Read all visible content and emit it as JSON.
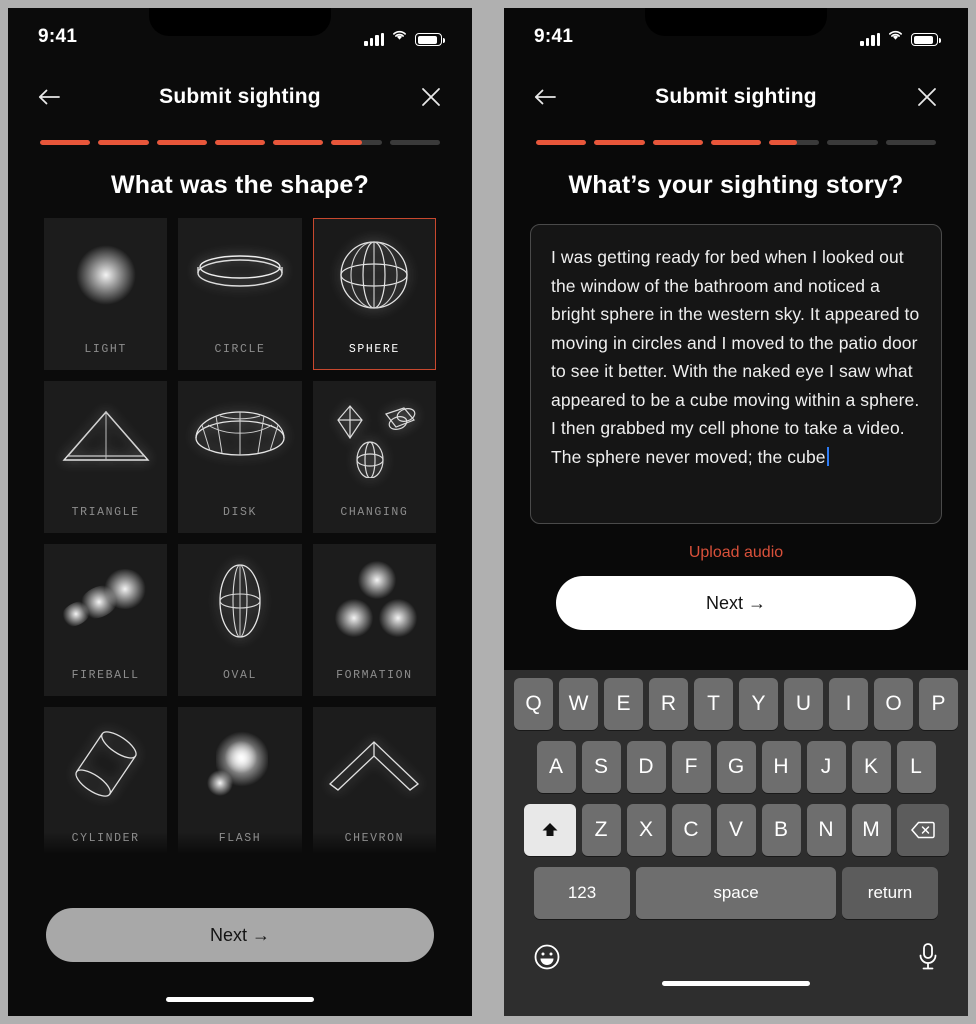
{
  "colors": {
    "accent_red": "#e8563a",
    "accent_link": "#d8503a",
    "selected_border": "#c8482e",
    "screen_bg": "#0b0b0b",
    "card_bg": "#1c1c1c",
    "caret_blue": "#2d7cf6",
    "page_bg": "#b0b0b0"
  },
  "left_screen": {
    "status": {
      "time": "9:41",
      "signal_icon": "cellular-bars-icon",
      "wifi_icon": "wifi-icon",
      "battery_icon": "battery-icon"
    },
    "nav": {
      "back_icon": "arrow-left-icon",
      "title": "Submit sighting",
      "close_icon": "close-x-icon"
    },
    "progress": {
      "segments": [
        100,
        100,
        100,
        100,
        100,
        60,
        0
      ]
    },
    "question": "What was the shape?",
    "shapes": [
      {
        "label": "LIGHT",
        "icon": "glowing-orb-icon",
        "selected": false
      },
      {
        "label": "CIRCLE",
        "icon": "flat-disc-ring-icon",
        "selected": false
      },
      {
        "label": "SPHERE",
        "icon": "wireframe-sphere-icon",
        "selected": true
      },
      {
        "label": "TRIANGLE",
        "icon": "wireframe-triangle-icon",
        "selected": false
      },
      {
        "label": "DISK",
        "icon": "wireframe-dome-icon",
        "selected": false
      },
      {
        "label": "CHANGING",
        "icon": "morphing-shapes-icon",
        "selected": false
      },
      {
        "label": "FIREBALL",
        "icon": "fireball-streak-icon",
        "selected": false
      },
      {
        "label": "OVAL",
        "icon": "wireframe-oval-icon",
        "selected": false
      },
      {
        "label": "FORMATION",
        "icon": "three-orbs-icon",
        "selected": false
      },
      {
        "label": "CYLINDER",
        "icon": "wireframe-cylinder-icon",
        "selected": false
      },
      {
        "label": "FLASH",
        "icon": "flash-blur-icon",
        "selected": false
      },
      {
        "label": "CHEVRON",
        "icon": "wireframe-chevron-icon",
        "selected": false
      },
      {
        "label": "",
        "icon": "partial-row-icon",
        "selected": false
      },
      {
        "label": "",
        "icon": "partial-row-blob-icon",
        "selected": false
      },
      {
        "label": "",
        "icon": "partial-row-cone-icon",
        "selected": false
      }
    ],
    "next_button": "Next  →"
  },
  "right_screen": {
    "status": {
      "time": "9:41",
      "signal_icon": "cellular-bars-icon",
      "wifi_icon": "wifi-icon",
      "battery_icon": "battery-icon"
    },
    "nav": {
      "back_icon": "arrow-left-icon",
      "title": "Submit sighting",
      "close_icon": "close-x-icon"
    },
    "progress": {
      "segments": [
        100,
        100,
        100,
        100,
        55,
        0,
        0
      ]
    },
    "question": "What’s your sighting story?",
    "story_text": "I was getting ready for bed when I looked out the window of the bathroom and noticed a bright sphere in the western sky. It appeared to moving in circles and I moved to the patio door to see it better. With the naked eye I saw what appeared to be a cube moving within a sphere. I then grabbed my cell phone to take a video. The sphere never moved; the cube",
    "upload_link": "Upload audio",
    "next_button": "Next  →",
    "keyboard": {
      "row1": [
        "Q",
        "W",
        "E",
        "R",
        "T",
        "Y",
        "U",
        "I",
        "O",
        "P"
      ],
      "row2": [
        "A",
        "S",
        "D",
        "F",
        "G",
        "H",
        "J",
        "K",
        "L"
      ],
      "row3": [
        "Z",
        "X",
        "C",
        "V",
        "B",
        "N",
        "M"
      ],
      "shift_icon": "shift-up-arrow-icon",
      "delete_icon": "backspace-delete-icon",
      "numbers_key": "123",
      "space_key": "space",
      "return_key": "return",
      "emoji_icon": "emoji-smiley-icon",
      "mic_icon": "microphone-icon"
    }
  }
}
